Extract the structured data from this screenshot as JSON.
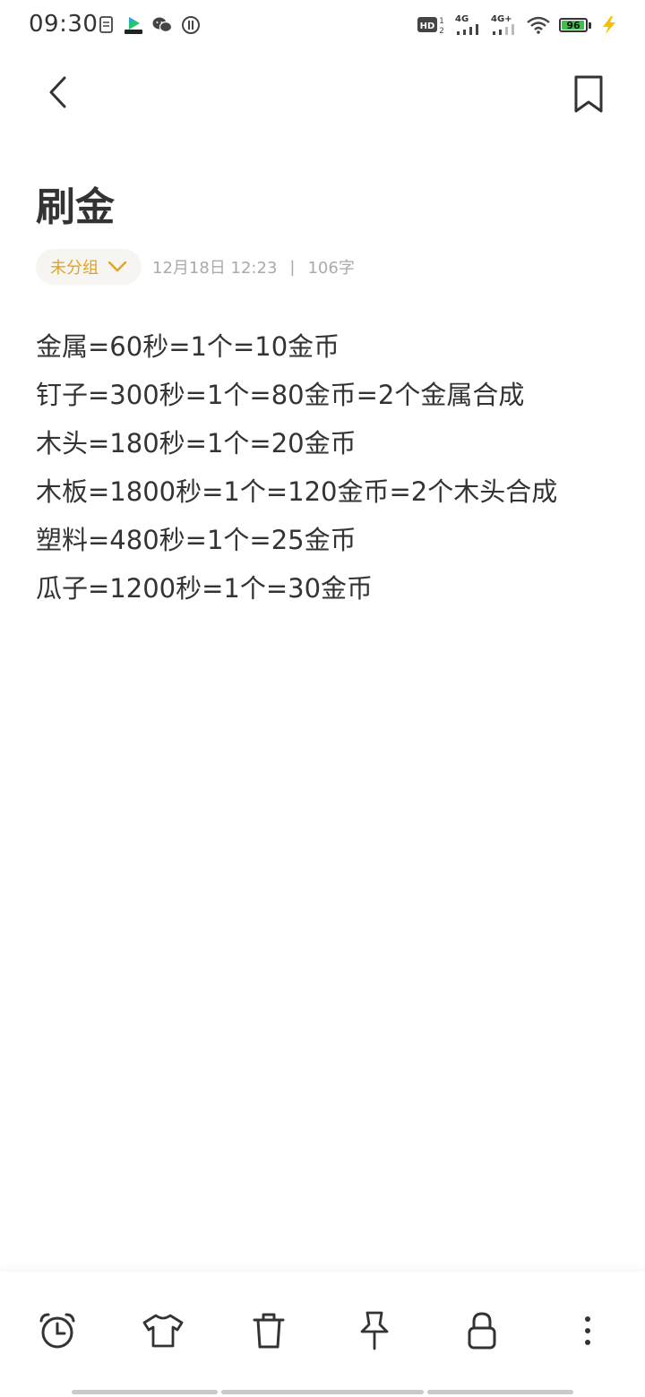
{
  "status_bar": {
    "time": "09:30",
    "battery_level": "96",
    "battery_fraction": 0.96,
    "network_1": "4G",
    "network_2": "4G+",
    "hd_label": "HD",
    "left_icons": [
      "document-icon",
      "video-app-icon",
      "wechat-icon",
      "usb-debug-icon"
    ],
    "right_icons": [
      "hd-voice-icon",
      "signal-4g-icon",
      "signal-4g-plus-icon",
      "wifi-icon",
      "battery-icon",
      "charging-icon"
    ]
  },
  "header": {
    "back_icon": "chevron-left-icon",
    "bookmark_icon": "bookmark-icon"
  },
  "note": {
    "title": "刷金",
    "group": "未分组",
    "date": "12月18日 12:23",
    "separator": "|",
    "word_count": "106字",
    "lines": [
      "金属=60秒=1个=10金币",
      "钉子=300秒=1个=80金币=2个金属合成",
      "木头=180秒=1个=20金币",
      "木板=1800秒=1个=120金币=2个木头合成",
      "塑料=480秒=1个=25金币",
      "瓜子=1200秒=1个=30金币"
    ]
  },
  "toolbar": {
    "items": [
      "alarm-clock-icon",
      "tshirt-icon",
      "trash-icon",
      "pin-icon",
      "lock-icon",
      "more-vertical-icon"
    ]
  },
  "colors": {
    "accent": "#e0a423",
    "text": "#333333",
    "meta": "#aaaaaa",
    "battery": "#3cc24a",
    "charging": "#f2c200"
  }
}
